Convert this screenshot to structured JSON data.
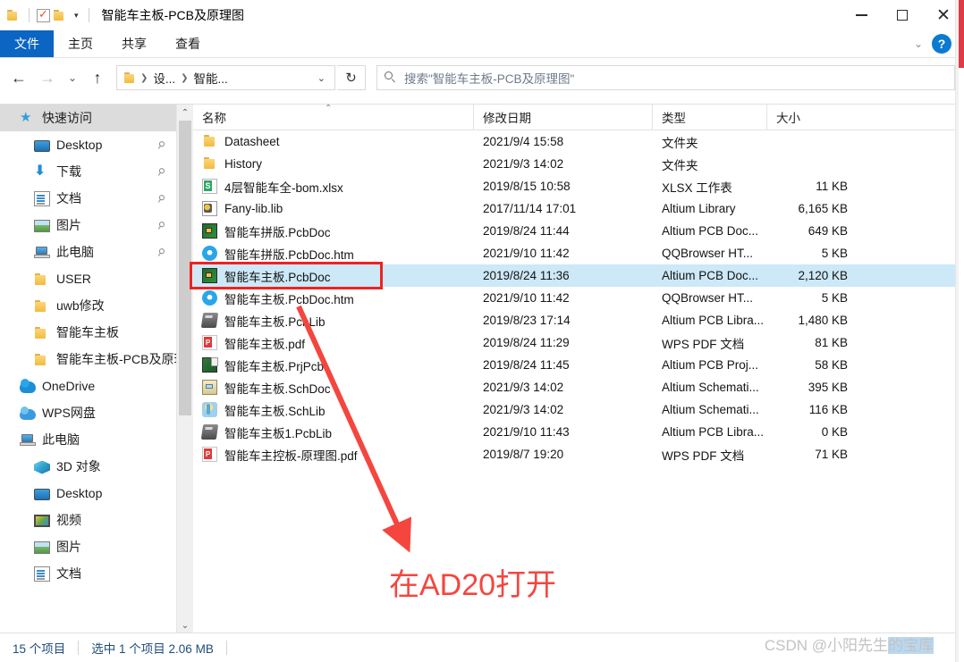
{
  "window": {
    "title": "智能车主板-PCB及原理图",
    "minimize_label": "最小化",
    "maximize_label": "最大化",
    "close_label": "关闭"
  },
  "quick_access_toolbar": {
    "items": [
      "folder-icon",
      "properties-checkbox-icon",
      "new-folder-icon",
      "customize-caret"
    ]
  },
  "ribbon": {
    "tabs": [
      {
        "label": "文件",
        "active": true
      },
      {
        "label": "主页",
        "active": false
      },
      {
        "label": "共享",
        "active": false
      },
      {
        "label": "查看",
        "active": false
      }
    ],
    "collapse_icon": "chevron-down-icon",
    "help_label": "?"
  },
  "address_bar": {
    "back_label": "←",
    "forward_label": "→",
    "recent_label": "⌄",
    "up_label": "↑",
    "breadcrumbs": [
      "设...",
      "智能..."
    ],
    "dropdown_label": "⌄",
    "refresh_label": "↻"
  },
  "search": {
    "placeholder": "搜索\"智能车主板-PCB及原理图\"",
    "icon": "search-icon"
  },
  "sidebar": {
    "scroll_up": "⌃",
    "scroll_down": "⌄",
    "items": [
      {
        "label": "快速访问",
        "icon": "quick-access-star-icon",
        "indent": 0,
        "selected": true,
        "pinned": false
      },
      {
        "label": "Desktop",
        "icon": "monitor-icon",
        "indent": 1,
        "selected": false,
        "pinned": true
      },
      {
        "label": "下载",
        "icon": "download-icon",
        "indent": 1,
        "selected": false,
        "pinned": true
      },
      {
        "label": "文档",
        "icon": "documents-icon",
        "indent": 1,
        "selected": false,
        "pinned": true
      },
      {
        "label": "图片",
        "icon": "pictures-icon",
        "indent": 1,
        "selected": false,
        "pinned": true
      },
      {
        "label": "此电脑",
        "icon": "this-pc-icon",
        "indent": 1,
        "selected": false,
        "pinned": true
      },
      {
        "label": "USER",
        "icon": "folder-icon",
        "indent": 1,
        "selected": false,
        "pinned": false
      },
      {
        "label": "uwb修改",
        "icon": "folder-icon",
        "indent": 1,
        "selected": false,
        "pinned": false
      },
      {
        "label": "智能车主板",
        "icon": "folder-icon",
        "indent": 1,
        "selected": false,
        "pinned": false
      },
      {
        "label": "智能车主板-PCB及原理",
        "icon": "folder-icon",
        "indent": 1,
        "selected": false,
        "pinned": false
      },
      {
        "label": "OneDrive",
        "icon": "onedrive-icon",
        "indent": 0,
        "selected": false,
        "pinned": false
      },
      {
        "label": "WPS网盘",
        "icon": "wps-cloud-icon",
        "indent": 0,
        "selected": false,
        "pinned": false
      },
      {
        "label": "此电脑",
        "icon": "this-pc-icon",
        "indent": 0,
        "selected": false,
        "pinned": false
      },
      {
        "label": "3D 对象",
        "icon": "3d-objects-icon",
        "indent": 1,
        "selected": false,
        "pinned": false
      },
      {
        "label": "Desktop",
        "icon": "monitor-icon",
        "indent": 1,
        "selected": false,
        "pinned": false
      },
      {
        "label": "视频",
        "icon": "videos-icon",
        "indent": 1,
        "selected": false,
        "pinned": false
      },
      {
        "label": "图片",
        "icon": "pictures-icon",
        "indent": 1,
        "selected": false,
        "pinned": false
      },
      {
        "label": "文档",
        "icon": "documents-icon",
        "indent": 1,
        "selected": false,
        "pinned": false
      }
    ]
  },
  "filelist": {
    "columns": [
      {
        "label": "名称",
        "key": "name"
      },
      {
        "label": "修改日期",
        "key": "date"
      },
      {
        "label": "类型",
        "key": "type"
      },
      {
        "label": "大小",
        "key": "size"
      }
    ],
    "sort_column": "名称",
    "sort_direction": "asc",
    "rows": [
      {
        "name": "Datasheet",
        "date": "2021/9/4 15:58",
        "type": "文件夹",
        "size": "",
        "icon": "folder",
        "selected": false
      },
      {
        "name": "History",
        "date": "2021/9/3 14:02",
        "type": "文件夹",
        "size": "",
        "icon": "folder",
        "selected": false
      },
      {
        "name": "4层智能车全-bom.xlsx",
        "date": "2019/8/15 10:58",
        "type": "XLSX 工作表",
        "size": "11 KB",
        "icon": "xlsx",
        "selected": false
      },
      {
        "name": "Fany-lib.lib",
        "date": "2017/11/14 17:01",
        "type": "Altium Library",
        "size": "6,165 KB",
        "icon": "altlib",
        "selected": false
      },
      {
        "name": "智能车拼版.PcbDoc",
        "date": "2019/8/24 11:44",
        "type": "Altium PCB Doc...",
        "size": "649 KB",
        "icon": "pcbdoc",
        "selected": false
      },
      {
        "name": "智能车拼版.PcbDoc.htm",
        "date": "2021/9/10 11:42",
        "type": "QQBrowser HT...",
        "size": "5 KB",
        "icon": "htm",
        "selected": false
      },
      {
        "name": "智能车主板.PcbDoc",
        "date": "2019/8/24 11:36",
        "type": "Altium PCB Doc...",
        "size": "2,120 KB",
        "icon": "pcbdoc",
        "selected": true
      },
      {
        "name": "智能车主板.PcbDoc.htm",
        "date": "2021/9/10 11:42",
        "type": "QQBrowser HT...",
        "size": "5 KB",
        "icon": "htm",
        "selected": false
      },
      {
        "name": "智能车主板.PcbLib",
        "date": "2019/8/23 17:14",
        "type": "Altium PCB Libra...",
        "size": "1,480 KB",
        "icon": "pcblib",
        "selected": false
      },
      {
        "name": "智能车主板.pdf",
        "date": "2019/8/24 11:29",
        "type": "WPS PDF 文档",
        "size": "81 KB",
        "icon": "pdf",
        "selected": false
      },
      {
        "name": "智能车主板.PrjPcb",
        "date": "2019/8/24 11:45",
        "type": "Altium PCB Proj...",
        "size": "58 KB",
        "icon": "prjpcb",
        "selected": false
      },
      {
        "name": "智能车主板.SchDoc",
        "date": "2021/9/3 14:02",
        "type": "Altium Schemati...",
        "size": "395 KB",
        "icon": "schdoc",
        "selected": false
      },
      {
        "name": "智能车主板.SchLib",
        "date": "2021/9/3 14:02",
        "type": "Altium Schemati...",
        "size": "116 KB",
        "icon": "schlib",
        "selected": false
      },
      {
        "name": "智能车主板1.PcbLib",
        "date": "2021/9/10 11:43",
        "type": "Altium PCB Libra...",
        "size": "0 KB",
        "icon": "pcblib",
        "selected": false
      },
      {
        "name": "智能车主控板-原理图.pdf",
        "date": "2019/8/7 19:20",
        "type": "WPS PDF 文档",
        "size": "71 KB",
        "icon": "pdf",
        "selected": false
      }
    ]
  },
  "annotation": {
    "text": "在AD20打开",
    "color": "#f4463f",
    "highlight_box_color": "#ef2222"
  },
  "statusbar": {
    "item_count": "15 个项目",
    "selection": "选中 1 个项目  2.06 MB"
  },
  "watermark": {
    "prefix": "CSDN @小阳先生",
    "highlighted": "的宝库"
  }
}
